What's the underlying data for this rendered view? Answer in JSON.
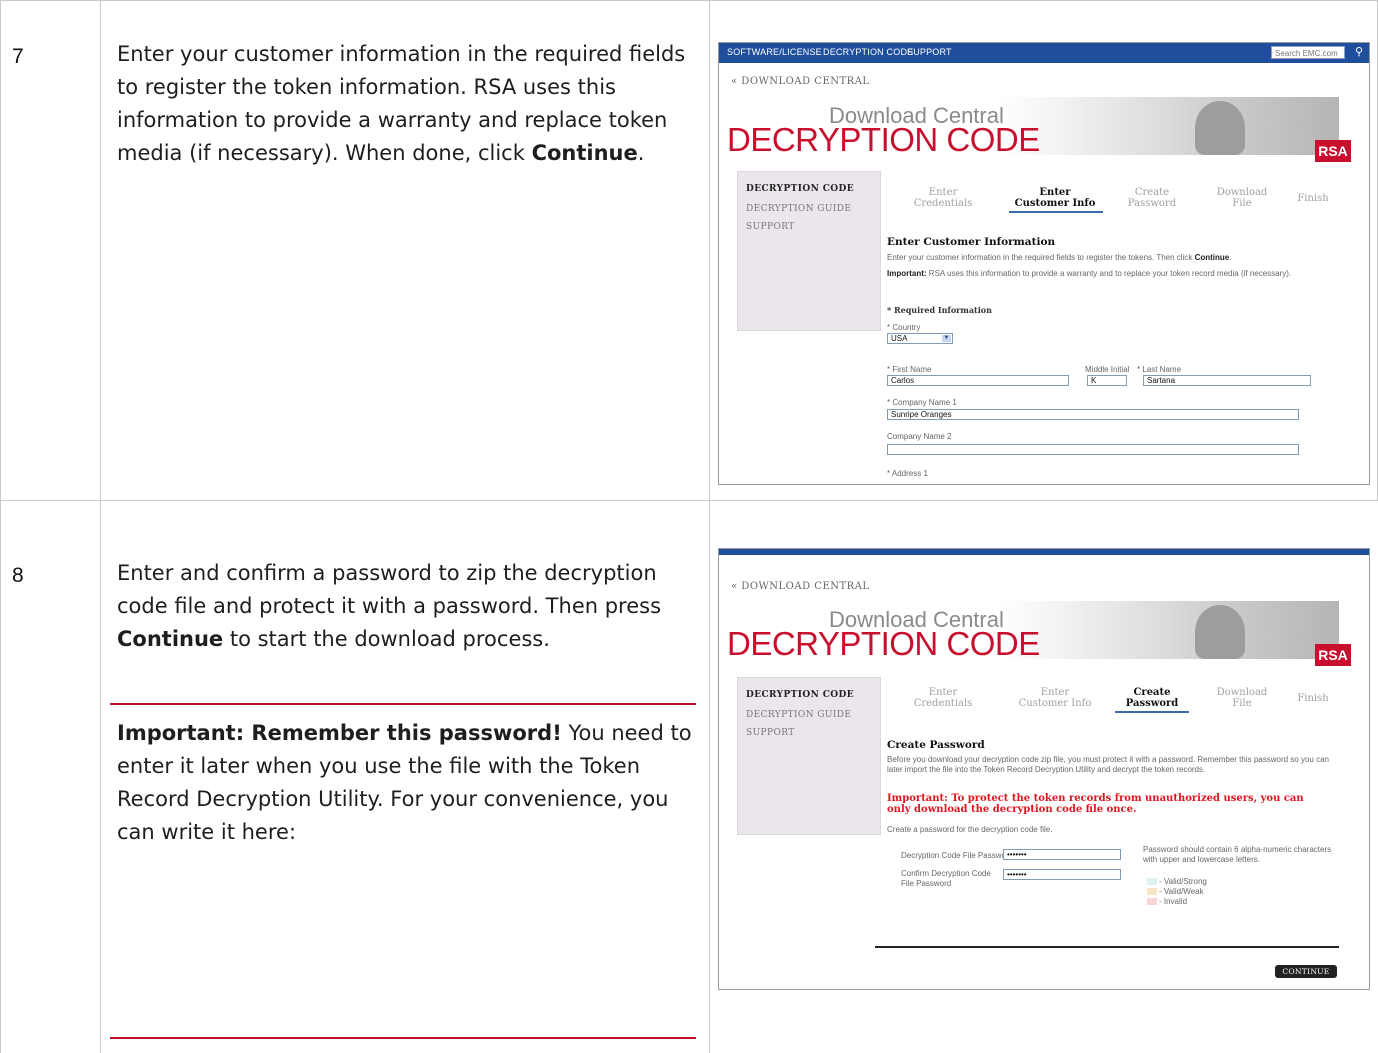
{
  "rows": [
    {
      "step": "7",
      "text_plain": "Enter your customer information in the required fields to register the token information. RSA uses this information to provide a warranty and replace token media (if necessary). When done, click ",
      "text_bold": "Continue",
      "text_after": "."
    },
    {
      "step": "8",
      "text_plain": "Enter and confirm a password to zip the decryption code file and protect it with a password. Then press ",
      "text_bold": "Continue",
      "text_after": " to start the download process.",
      "important_bold": "Important:  Remember this password!",
      "important_text": " You need to enter it later when you use the file with the Token Record Decryption Utility. For your convenience, you can write it here:"
    }
  ],
  "shot1": {
    "nav": [
      "SOFTWARE/LICENSE",
      "DECRYPTION CODE",
      "SUPPORT"
    ],
    "search_placeholder": "Search EMC.com",
    "breadcrumb": "« DOWNLOAD CENTRAL",
    "subtitle": "Download Central",
    "title": "DECRYPTION CODE",
    "logo": "RSA",
    "sidebar": [
      "DECRYPTION CODE",
      "DECRYPTION GUIDE",
      "SUPPORT"
    ],
    "steps": [
      {
        "l1": "Enter",
        "l2": "Credentials"
      },
      {
        "l1": "Enter",
        "l2": "Customer Info"
      },
      {
        "l1": "Create",
        "l2": "Password"
      },
      {
        "l1": "Download",
        "l2": "File"
      },
      {
        "l1": "Finish",
        "l2": ""
      }
    ],
    "section_title": "Enter Customer Information",
    "intro": "Enter your customer information in the required fields to register the tokens. Then click ",
    "intro_bold": "Continue",
    "important_label": "Important:",
    "important_text": " RSA uses this information to provide a warranty and to replace your token record media (if necessary).",
    "required": "* Required Information",
    "country_label": "* Country",
    "country_value": "USA",
    "first_name_label": "* First Name",
    "first_name_value": "Carlos",
    "middle_label": "Middle Initial",
    "middle_value": "K",
    "last_name_label": "* Last Name",
    "last_name_value": "Sartana",
    "company1_label": "* Company Name 1",
    "company1_value": "Sunripe Oranges",
    "company2_label": "Company Name 2",
    "company2_value": "",
    "address1_label": "* Address 1"
  },
  "shot2": {
    "breadcrumb": "« DOWNLOAD CENTRAL",
    "subtitle": "Download Central",
    "title": "DECRYPTION CODE",
    "logo": "RSA",
    "sidebar": [
      "DECRYPTION CODE",
      "DECRYPTION GUIDE",
      "SUPPORT"
    ],
    "steps": [
      {
        "l1": "Enter",
        "l2": "Credentials"
      },
      {
        "l1": "Enter",
        "l2": "Customer Info"
      },
      {
        "l1": "Create",
        "l2": "Password"
      },
      {
        "l1": "Download",
        "l2": "File"
      },
      {
        "l1": "Finish",
        "l2": ""
      }
    ],
    "section_title": "Create Password",
    "intro": "Before you download your decryption code zip file, you must protect it with a password. Remember this password so you can later import the file into the Token Record Decryption Utility and decrypt the token records.",
    "warning": "Important: To protect the token records from unauthorized users, you can only download the decryption code file once.",
    "create_text": "Create a password for the decryption code file.",
    "pw_label": "Decryption Code File Password",
    "pw_value": "•••••••",
    "confirm_label": "Confirm Decryption Code File Password",
    "confirm_value": "•••••••",
    "hint": "Password should contain 6 alpha-numeric characters with upper and lowercase letters.",
    "legend": [
      {
        "label": "- Valid/Strong",
        "color": "#dff0f2"
      },
      {
        "label": "- Valid/Weak",
        "color": "#fbe3c6"
      },
      {
        "label": "- Invalid",
        "color": "#f8d6d6"
      }
    ],
    "continue_label": "CONTINUE"
  }
}
